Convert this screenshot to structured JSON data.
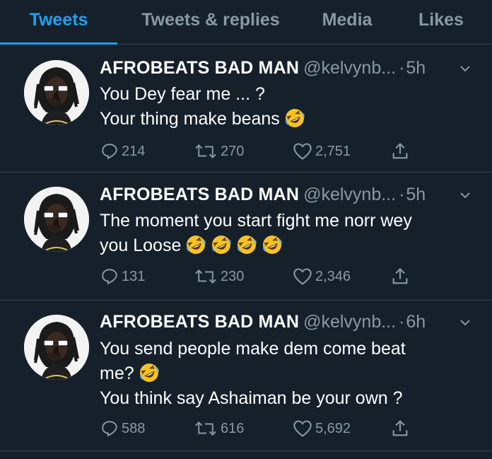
{
  "tabs": [
    {
      "label": "Tweets",
      "active": true
    },
    {
      "label": "Tweets & replies",
      "active": false
    },
    {
      "label": "Media",
      "active": false
    },
    {
      "label": "Likes",
      "active": false
    }
  ],
  "colors": {
    "accent": "#1da1f2",
    "background": "#15202b",
    "muted": "#8899a6",
    "divider": "#38444d"
  },
  "tweets": [
    {
      "name": "AFROBEATS BAD MAN",
      "handle": "@kelvynb...",
      "separator": "·",
      "time": "5h",
      "lines": [
        "You Dey fear me ... ?",
        "Your thing make beans"
      ],
      "emoji": "rolling-on-the-floor-laughing",
      "replies": "214",
      "retweets": "270",
      "likes": "2,751"
    },
    {
      "name": "AFROBEATS BAD MAN",
      "handle": "@kelvynb...",
      "separator": "·",
      "time": "5h",
      "lines": [
        "The moment you start fight me norr wey",
        "you Loose"
      ],
      "emoji": "rolling-on-the-floor-laughing x4",
      "replies": "131",
      "retweets": "230",
      "likes": "2,346"
    },
    {
      "name": "AFROBEATS BAD MAN",
      "handle": "@kelvynb...",
      "separator": "·",
      "time": "6h",
      "lines": [
        "You send people make dem come beat",
        "me?",
        "You think say Ashaiman be your own ?"
      ],
      "emoji": "rolling-on-the-floor-laughing",
      "replies": "588",
      "retweets": "616",
      "likes": "5,692"
    }
  ]
}
